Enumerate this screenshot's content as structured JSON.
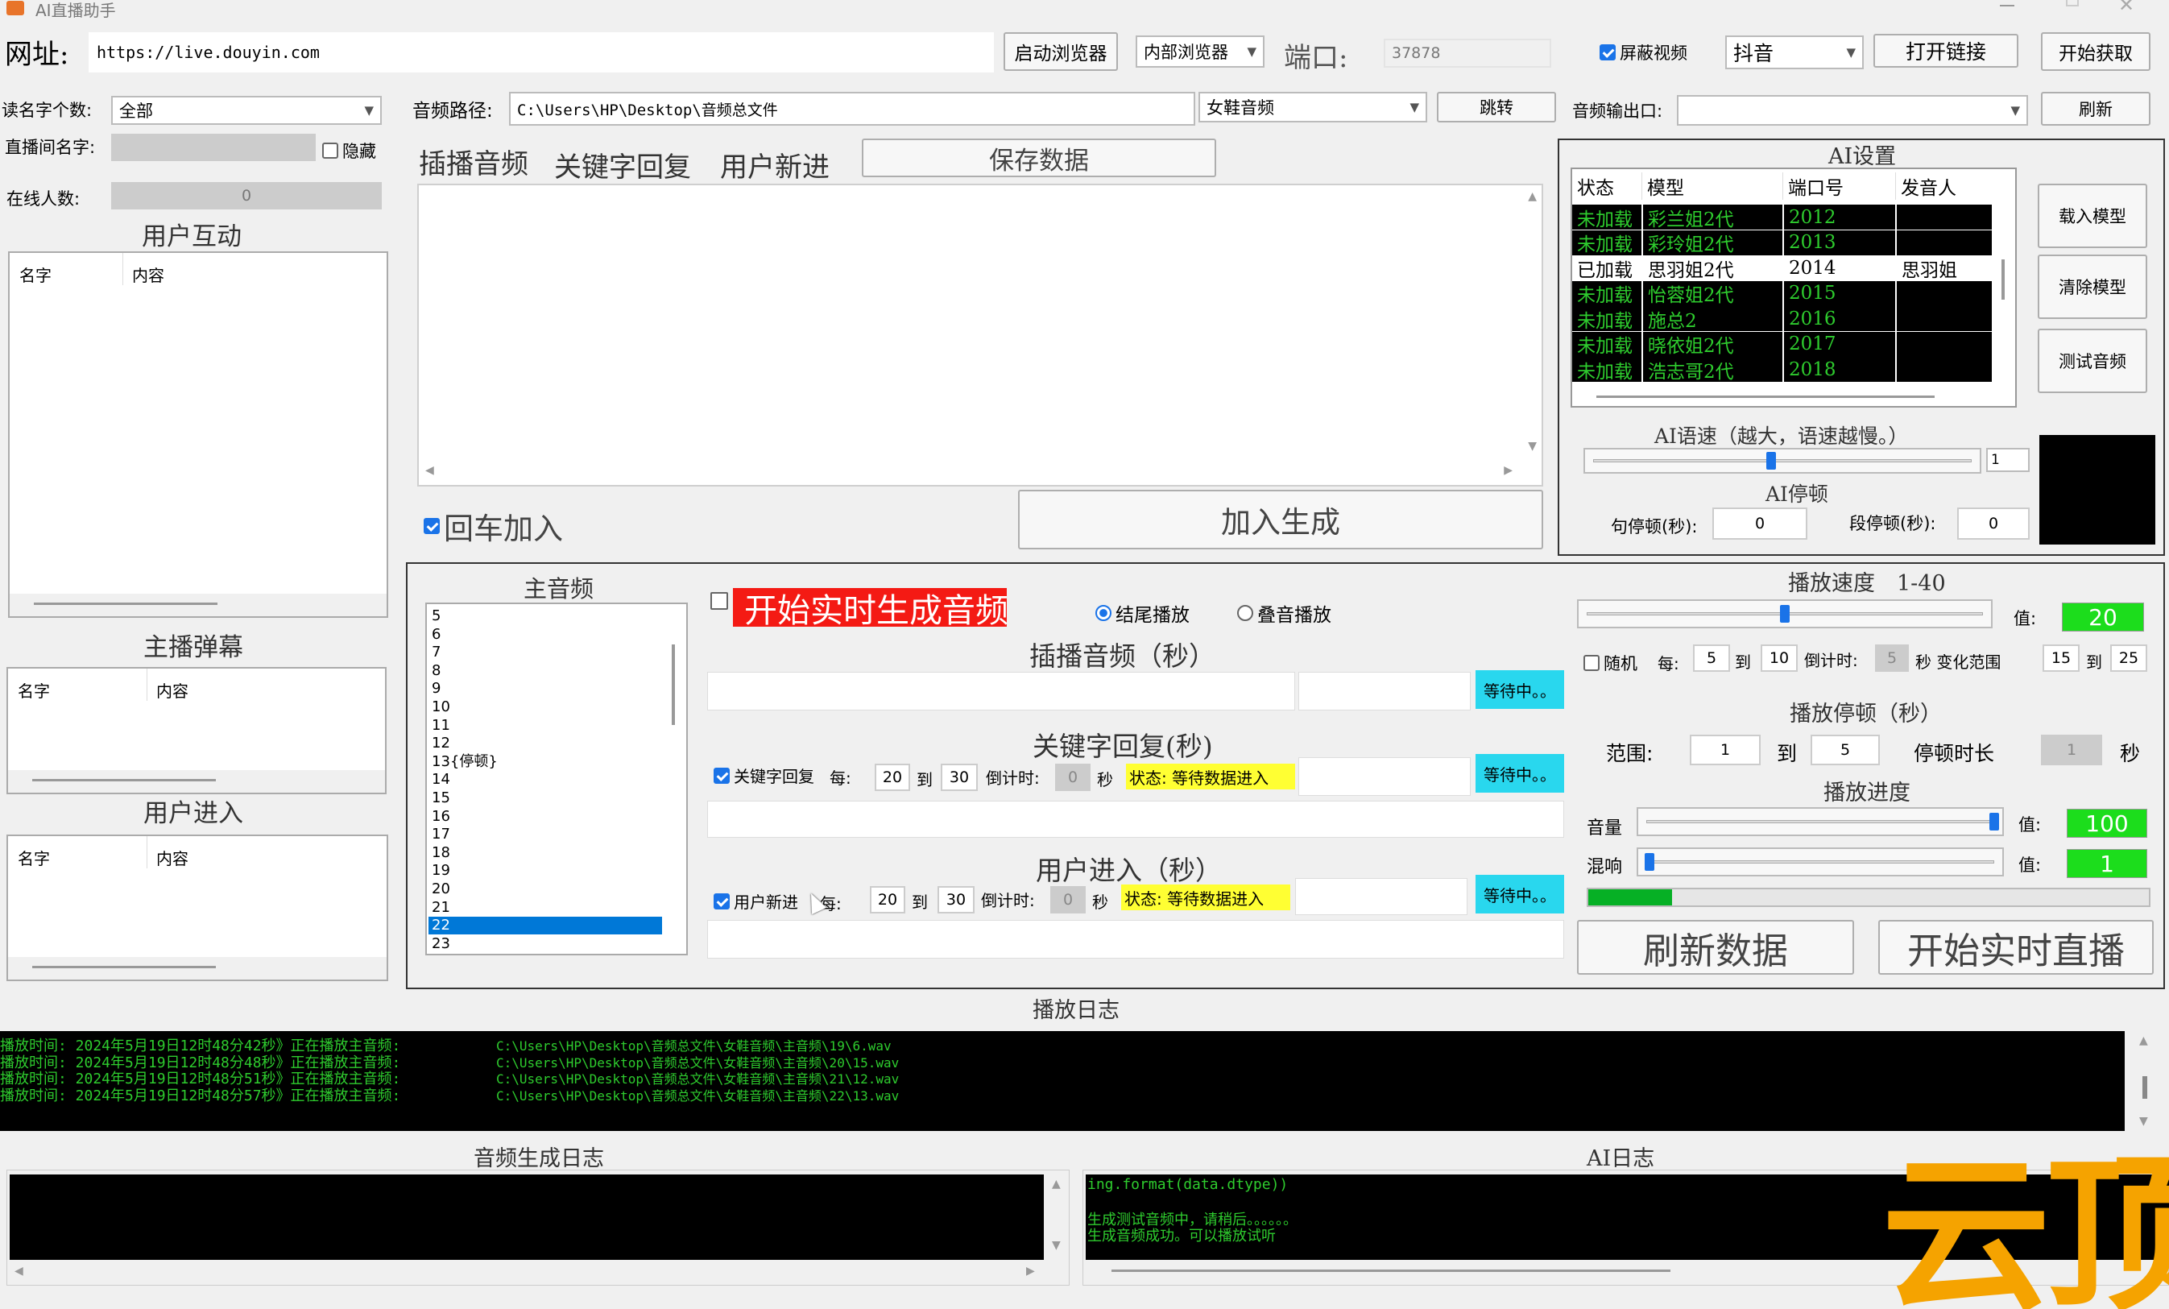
{
  "window": {
    "title": "AI直播助手"
  },
  "top": {
    "url_label": "网址:",
    "url_value": "https://live.douyin.com",
    "launch_browser": "启动浏览器",
    "browser_select": "内部浏览器",
    "port_label": "端口:",
    "port_value": "37878",
    "hide_video": "屏蔽视频",
    "platform_select": "抖音",
    "open_link": "打开链接",
    "start_fetch": "开始获取"
  },
  "left": {
    "read_name_label": "读名字个数:",
    "read_name_select": "全部",
    "room_name_label": "直播间名字:",
    "hide_label": "隐藏",
    "online_label": "在线人数:",
    "online_value": "0",
    "user_interact_title": "用户互动",
    "anchor_danmu_title": "主播弹幕",
    "user_enter_title": "用户进入",
    "col_name": "名字",
    "col_content": "内容"
  },
  "audio": {
    "path_label": "音频路径:",
    "path_value": "C:\\Users\\HP\\Desktop\\音频总文件",
    "folder_select": "女鞋音频",
    "jump": "跳转",
    "output_label": "音频输出口:",
    "refresh": "刷新"
  },
  "tabs": {
    "t1": "插播音频",
    "t2": "关键字回复",
    "t3": "用户新进",
    "save": "保存数据",
    "enter_add": "回车加入",
    "add_generate": "加入生成"
  },
  "ai": {
    "title": "AI设置",
    "headers": [
      "状态",
      "模型",
      "端口号",
      "发音人"
    ],
    "models": [
      {
        "status": "未加载",
        "model": "彩兰姐2代",
        "port": "2012",
        "speaker": "",
        "loaded": false
      },
      {
        "status": "未加载",
        "model": "彩玲姐2代",
        "port": "2013",
        "speaker": "",
        "loaded": false
      },
      {
        "status": "已加载",
        "model": "思羽姐2代",
        "port": "2014",
        "speaker": "思羽姐",
        "loaded": true
      },
      {
        "status": "未加载",
        "model": "怡蓉姐2代",
        "port": "2015",
        "speaker": "",
        "loaded": false
      },
      {
        "status": "未加载",
        "model": "施总2",
        "port": "2016",
        "speaker": "",
        "loaded": false
      },
      {
        "status": "未加载",
        "model": "晓依姐2代",
        "port": "2017",
        "speaker": "",
        "loaded": false
      },
      {
        "status": "未加载",
        "model": "浩志哥2代",
        "port": "2018",
        "speaker": "",
        "loaded": false
      }
    ],
    "load_model": "载入模型",
    "clear_model": "清除模型",
    "test_audio": "测试音频",
    "speed_title": "AI语速（越大，语速越慢。）",
    "speed_value": "1",
    "speed_level": 0.47,
    "pause_title": "AI停顿",
    "sentence_pause_label": "句停顿(秒):",
    "sentence_pause_value": "0",
    "para_pause_label": "段停顿(秒):",
    "para_pause_value": "0"
  },
  "main_audio": {
    "title": "主音频",
    "items": [
      "5",
      "6",
      "7",
      "8",
      "9",
      "10",
      "11",
      "12",
      "13{停顿}",
      "14",
      "15",
      "16",
      "17",
      "18",
      "19",
      "20",
      "21",
      "22",
      "23"
    ],
    "selected": "22"
  },
  "realtime": {
    "start_gen": "开始实时生成音频",
    "end_play": "结尾播放",
    "overlay_play": "叠音播放",
    "insert_title": "插播音频（秒）",
    "waiting": "等待中。。",
    "keyword_title": "关键字回复(秒)",
    "keyword_cb": "关键字回复",
    "every": "每:",
    "kw_from": "20",
    "to": "到",
    "kw_to": "30",
    "countdown": "倒计时:",
    "kw_countdown": "0",
    "sec": "秒",
    "status": "状态: 等待数据进入",
    "user_title": "用户进入（秒）",
    "user_cb": "用户新进",
    "us_from": "20",
    "us_to": "30",
    "us_countdown": "0"
  },
  "play": {
    "speed_title": "播放速度　1-40",
    "value_label": "值:",
    "speed_value": "20",
    "speed_level": 0.5,
    "random": "随机",
    "every": "每:",
    "r_from": "5",
    "to": "到",
    "r_to": "10",
    "countdown": "倒计时:",
    "r_countdown": "5",
    "sec_range": "秒 变化范围",
    "range_from": "15",
    "range_to": "25",
    "pause_title": "播放停顿（秒）",
    "range_label": "范围:",
    "p_from": "1",
    "p_to": "5",
    "pause_len_label": "停顿时长",
    "pause_len": "1",
    "sec": "秒",
    "progress_title": "播放进度",
    "volume_label": "音量",
    "volume_value": "100",
    "volume_level": 1.0,
    "reverb_label": "混响",
    "reverb_value": "1",
    "reverb_level": 0.01,
    "progress": 0.15,
    "refresh_data": "刷新数据",
    "start_live": "开始实时直播"
  },
  "logs": {
    "play_title": "播放日志",
    "play_lines": [
      {
        "text": "播放时间: 2024年5月19日12时48分42秒》正在播放主音频:",
        "path": "C:\\Users\\HP\\Desktop\\音频总文件\\女鞋音频\\主音频\\19\\6.wav"
      },
      {
        "text": "播放时间: 2024年5月19日12时48分48秒》正在播放主音频:",
        "path": "C:\\Users\\HP\\Desktop\\音频总文件\\女鞋音频\\主音频\\20\\15.wav"
      },
      {
        "text": "播放时间: 2024年5月19日12时48分51秒》正在播放主音频:",
        "path": "C:\\Users\\HP\\Desktop\\音频总文件\\女鞋音频\\主音频\\21\\12.wav"
      },
      {
        "text": "播放时间: 2024年5月19日12时48分57秒》正在播放主音频:",
        "path": "C:\\Users\\HP\\Desktop\\音频总文件\\女鞋音频\\主音频\\22\\13.wav"
      }
    ],
    "gen_title": "音频生成日志",
    "ai_title": "AI日志",
    "ai_lines": [
      "ing.format(data.dtype))",
      "",
      "生成测试音频中，请稍后。。。。。。",
      "生成音频成功。可以播放试听"
    ]
  },
  "watermark": "云顶",
  "colors": {
    "accent": "#1a73e8",
    "green_text": "#2ecc2e",
    "value_green": "#1cdd1c",
    "waiting": "#29d7ee",
    "start_red": "#f41a14",
    "status_yellow": "#ffff33",
    "watermark": "#f5a300"
  }
}
